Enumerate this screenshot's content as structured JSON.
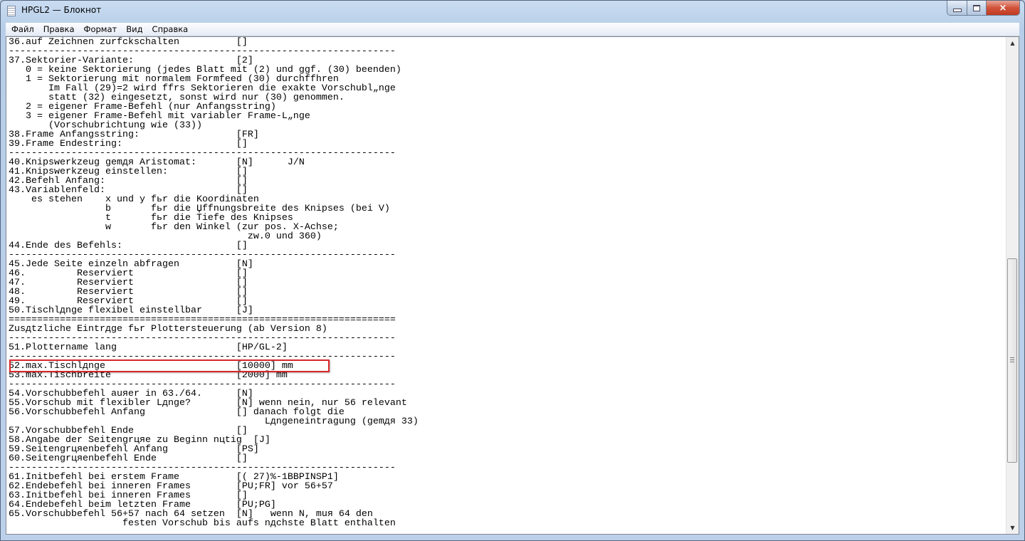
{
  "window": {
    "title": "HPGL2 — Блокнот",
    "close_icon": "×"
  },
  "menu": [
    {
      "label": "Файл"
    },
    {
      "label": "Правка"
    },
    {
      "label": "Формат"
    },
    {
      "label": "Вид"
    },
    {
      "label": "Справка"
    }
  ],
  "colors": {
    "highlight": "#d8262b"
  },
  "editor": {
    "highlighted_line": 35,
    "lines": [
      "36.auf Zeichnen zurfckschalten          []",
      "--------------------------------------------------------------------",
      "37.Sektorier-Variante:                  [2]",
      "   0 = keine Sektorierung (jedes Blatt mit (2) und ggf. (30) beenden)",
      "   1 = Sektorierung mit normalem Formfeed (30) durchffhren",
      "       Im Fall (29)=2 wird ffrs Sektorieren die exakte Vorschubl„nge",
      "       statt (32) eingesetzt, sonst wird nur (30) genommen.",
      "   2 = eigener Frame-Befehl (nur Anfangsstring)",
      "   3 = eigener Frame-Befehl mit variabler Frame-L„nge",
      "       (Vorschubrichtung wie (33))",
      "38.Frame Anfangsstring:                 [FR]",
      "39.Frame Endestring:                    []",
      "--------------------------------------------------------------------",
      "40.Knipswerkzeug gemдя Aristomat:       [N]      J/N",
      "41.Knipswerkzeug einstellen:            []",
      "42.Befehl Anfang:                       []",
      "43.Variablenfeld:                       []",
      "    es stehen    x und y fьr die Koordinaten",
      "                 b       fьr die Џffnungsbreite des Knipses (bei V)",
      "                 t       fьr die Tiefe des Knipses",
      "                 w       fьr den Winkel (zur pos. X-Achse;",
      "                                          zw.0 und 360)",
      "44.Ende des Befehls:                    []",
      "--------------------------------------------------------------------",
      "45.Jede Seite einzeln abfragen          [N]",
      "46.         Reserviert                  []",
      "47.         Reserviert                  []",
      "48.         Reserviert                  []",
      "49.         Reserviert                  []",
      "50.Tischlдnge flexibel einstellbar      [J]",
      "====================================================================",
      "Zusдtzliche Eintrдge fьr Plottersteuerung (ab Version 8)",
      "--------------------------------------------------------------------",
      "51.Plottername lang                     [HP/GL-2]",
      "--------------------------------------------------------------------",
      "52.max.Tischlдnge                       [10000] mm",
      "53.max.Tischbreite                      [2000] mm",
      "--------------------------------------------------------------------",
      "54.Vorschubbefehl auяer in 63./64.      [N]",
      "55.Vorschub mit flexibler Lдnge?        [N] wenn nein, nur 56 relevant",
      "56.Vorschubbefehl Anfang                [] danach folgt die",
      "                                             Lдngeneintragung (gemдя 33)",
      "57.Vorschubbefehl Ende                  []",
      "58.Angabe der Seitengrцяe zu Beginn nцtig  [J]",
      "59.Seitengrцяenbefehl Anfang            [PS]",
      "60.Seitengrцяenbefehl Ende              []",
      "--------------------------------------------------------------------",
      "61.Initbefehl bei erstem Frame          [( 27)%-1BBPINSP1]",
      "62.Endebefehl bei inneren Frames        [PU;FR] vor 56+57",
      "63.Initbefehl bei inneren Frames        []",
      "64.Endebefehl beim letzten Frame        [PU;PG]",
      "65.Vorschubbefehl 56+57 nach 64 setzen  [N]   wenn N, muя 64 den",
      "                    festen Vorschub bis aufs nдchste Blatt enthalten"
    ]
  },
  "scrollbar": {
    "position_fraction": 0.42,
    "visible_fraction": 0.41
  }
}
